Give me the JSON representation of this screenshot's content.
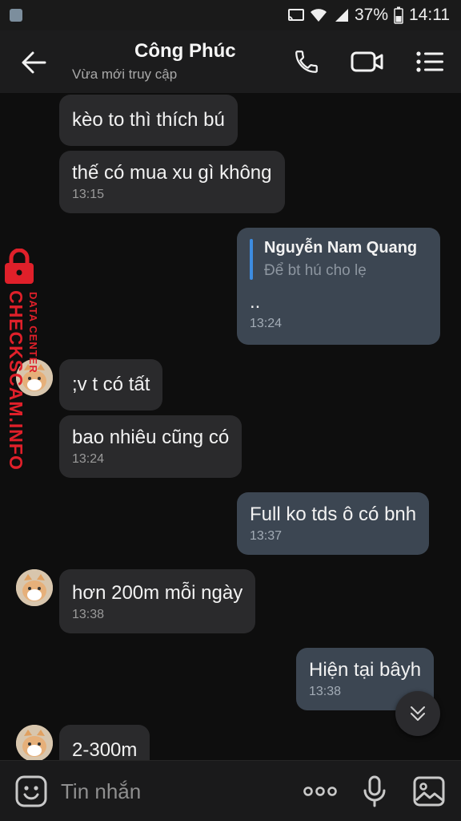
{
  "status_bar": {
    "battery": "37%",
    "time": "14:11"
  },
  "header": {
    "contact_name": "Công Phúc",
    "status": "Vừa mới truy cập"
  },
  "messages": [
    {
      "dir": "in",
      "text": "kèo to thì thích bú",
      "time": ""
    },
    {
      "dir": "in",
      "text": "thế có mua xu gì không",
      "time": "13:15"
    },
    {
      "dir": "out",
      "quote_name": "Nguyễn Nam Quang",
      "quote_text": "Để bt hú cho lẹ",
      "text": "..",
      "time": "13:24"
    },
    {
      "dir": "in",
      "text": ";v t có tất",
      "time": ""
    },
    {
      "dir": "in",
      "text": "bao nhiêu cũng có",
      "time": "13:24"
    },
    {
      "dir": "out",
      "text": "Full ko tds ô có bnh",
      "time": "13:37"
    },
    {
      "dir": "in",
      "text": "hơn 200m mỗi ngày",
      "time": "13:38"
    },
    {
      "dir": "out",
      "text": "Hiện tại bâyh",
      "time": "13:38"
    },
    {
      "dir": "in",
      "text": "2-300m",
      "time": ""
    }
  ],
  "watermark": {
    "line1": "DATA CENTER",
    "line2": "CHECKSCAM.INFO"
  },
  "composer": {
    "placeholder": "Tin nhắn"
  },
  "icons": {
    "back": "arrow-left-icon",
    "call": "phone-icon",
    "video": "video-camera-icon",
    "menu": "list-menu-icon",
    "emoji": "emoji-icon",
    "more": "more-dots-icon",
    "mic": "microphone-icon",
    "image": "image-icon",
    "scroll": "chevron-double-down-icon"
  },
  "colors": {
    "incoming_bubble": "#2a2a2c",
    "outgoing_bubble": "#3c4652",
    "quote_bar": "#3d8ce0",
    "watermark": "#e0202a"
  }
}
